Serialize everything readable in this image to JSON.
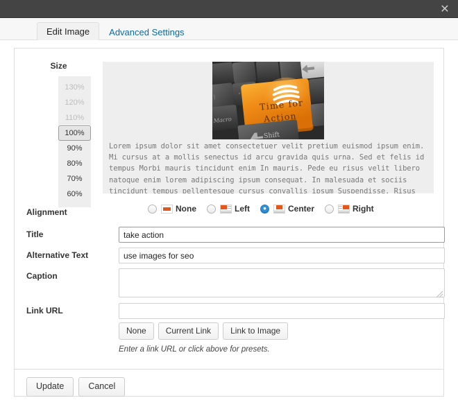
{
  "window": {
    "close_icon": "close-icon"
  },
  "tabs": [
    {
      "label": "Edit Image",
      "active": true
    },
    {
      "label": "Advanced Settings",
      "active": false
    }
  ],
  "size": {
    "label": "Size",
    "options": [
      {
        "value": "130%",
        "state": "disabled"
      },
      {
        "value": "120%",
        "state": "disabled"
      },
      {
        "value": "110%",
        "state": "disabled"
      },
      {
        "value": "100%",
        "state": "selected"
      },
      {
        "value": "90%",
        "state": "enabled"
      },
      {
        "value": "80%",
        "state": "enabled"
      },
      {
        "value": "70%",
        "state": "enabled"
      },
      {
        "value": "60%",
        "state": "enabled"
      }
    ]
  },
  "preview": {
    "image_alt": "keyboard with orange Time for Action key",
    "image_key_line1": "Time for",
    "image_key_line2": "Action",
    "body_text": "Lorem ipsum dolor sit amet consectetuer velit pretium euismod ipsum enim. Mi cursus at a mollis senectus id arcu gravida quis urna. Sed et felis id tempus Morbi mauris tincidunt enim In mauris. Pede eu risus velit libero natoque enim lorem adipiscing ipsum consequat. In malesuada et sociis tincidunt tempus pellentesque cursus convallis ipsum Suspendisse. Risus In ac quis ut Nunc convallis laoreet ante Suspendisse Nam. Amet amet"
  },
  "alignment": {
    "label": "Alignment",
    "selected": "Center",
    "options": [
      {
        "label": "None",
        "selected": false
      },
      {
        "label": "Left",
        "selected": false
      },
      {
        "label": "Center",
        "selected": true
      },
      {
        "label": "Right",
        "selected": false
      }
    ]
  },
  "fields": {
    "title": {
      "label": "Title",
      "value": "take action",
      "placeholder": "",
      "focused": true
    },
    "alt": {
      "label": "Alternative Text",
      "value": "use images for seo",
      "placeholder": ""
    },
    "caption": {
      "label": "Caption",
      "value": "",
      "placeholder": ""
    },
    "link": {
      "label": "Link URL",
      "value": "",
      "placeholder": ""
    }
  },
  "link_presets": {
    "buttons": [
      "None",
      "Current Link",
      "Link to Image"
    ],
    "hint": "Enter a link URL or click above for presets."
  },
  "footer": {
    "update_label": "Update",
    "cancel_label": "Cancel"
  },
  "colors": {
    "accent_orange": "#e2571e",
    "link_blue": "#0b6aa2",
    "radio_blue": "#2f8ed4",
    "titlebar": "#444444"
  }
}
